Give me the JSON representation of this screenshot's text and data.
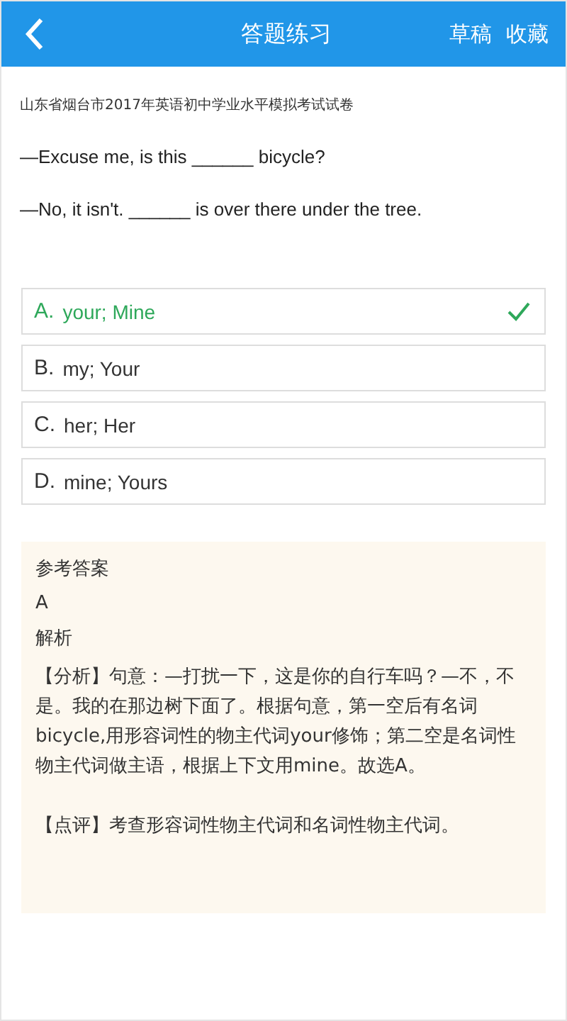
{
  "header": {
    "title": "答题练习",
    "actions": [
      "草稿",
      "收藏"
    ]
  },
  "source": "山东省烟台市2017年英语初中学业水平模拟考试试卷",
  "question": [
    "—Excuse me, is this ______ bicycle?",
    "—No, it isn't. ______ is over there under the tree."
  ],
  "options": [
    {
      "letter": "A.",
      "text": "your; Mine",
      "selected": true
    },
    {
      "letter": "B.",
      "text": "my; Your",
      "selected": false
    },
    {
      "letter": "C.",
      "text": "her; Her",
      "selected": false
    },
    {
      "letter": "D.",
      "text": "mine; Yours",
      "selected": false
    }
  ],
  "answer": {
    "heading": "参考答案",
    "value": "A",
    "analysis_heading": "解析",
    "analysis": "【分析】句意：—打扰一下，这是你的自行车吗？—不，不是。我的在那边树下面了。根据句意，第一空后有名词bicycle,用形容词性的物主代词your修饰；第二空是名词性物主代词做主语，根据上下文用mine。故选A。",
    "comment": "【点评】考查形容词性物主代词和名词性物主代词。"
  }
}
